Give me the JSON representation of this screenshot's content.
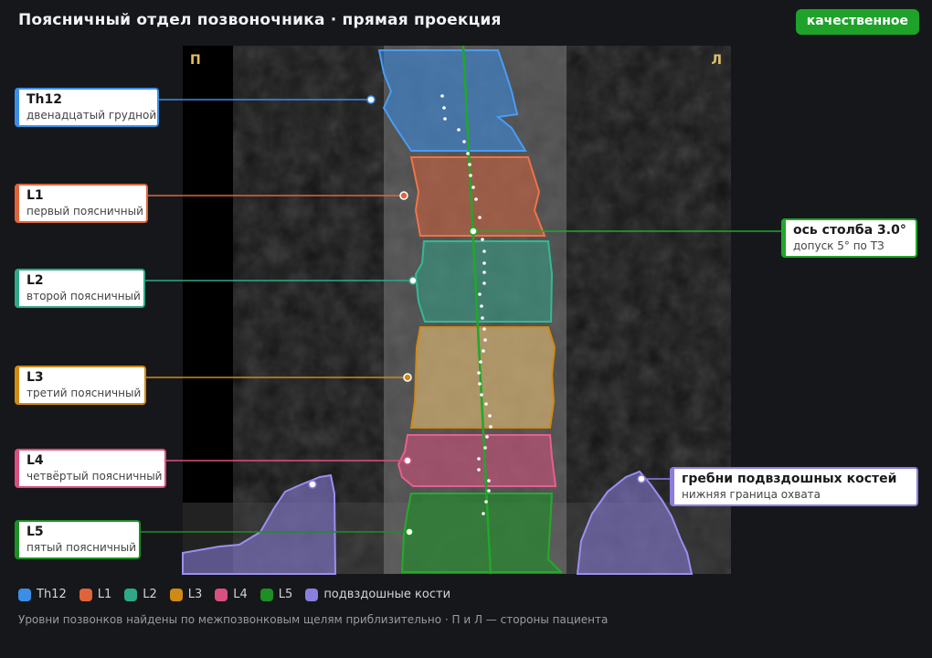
{
  "header": {
    "title": "Поясничный отдел позвоночника · прямая проекция",
    "quality_badge": "качественное",
    "quality_color": "#1ea22a"
  },
  "viewer": {
    "right_side_marker": "П",
    "left_side_marker": "Л"
  },
  "vertebrae": [
    {
      "key": "th12",
      "name": "Th12",
      "description": "двенадцатый грудной",
      "color": "#3b8ee8"
    },
    {
      "key": "l1",
      "name": "L1",
      "description": "первый поясничный",
      "color": "#e0643a"
    },
    {
      "key": "l2",
      "name": "L2",
      "description": "второй поясничный",
      "color": "#2ea889"
    },
    {
      "key": "l3",
      "name": "L3",
      "description": "третий поясничный",
      "color": "#cf8a14"
    },
    {
      "key": "l4",
      "name": "L4",
      "description": "четвёртый поясничный",
      "color": "#d9507f"
    },
    {
      "key": "l5",
      "name": "L5",
      "description": "пятый поясничный",
      "color": "#1d8f24"
    }
  ],
  "axis": {
    "label": "ось столба 3.0°",
    "note": "допуск 5° по ТЗ",
    "angle_deg": 3.0,
    "tolerance_deg": 5,
    "color": "#1fa82a"
  },
  "iliac": {
    "label": "гребни подвздошных костей",
    "note": "нижняя граница охвата",
    "color": "#8a7fe0"
  },
  "legend": [
    {
      "label": "Th12",
      "color": "#3b8ee8"
    },
    {
      "label": "L1",
      "color": "#e0643a"
    },
    {
      "label": "L2",
      "color": "#2ea889"
    },
    {
      "label": "L3",
      "color": "#cf8a14"
    },
    {
      "label": "L4",
      "color": "#d9507f"
    },
    {
      "label": "L5",
      "color": "#1d8f24"
    },
    {
      "label": "подвздошные кости",
      "color": "#8a7fe0"
    }
  ],
  "footnote": "Уровни позвонков найдены по межпозвонковым щелям приблизительно · П и Л — стороны пациента"
}
